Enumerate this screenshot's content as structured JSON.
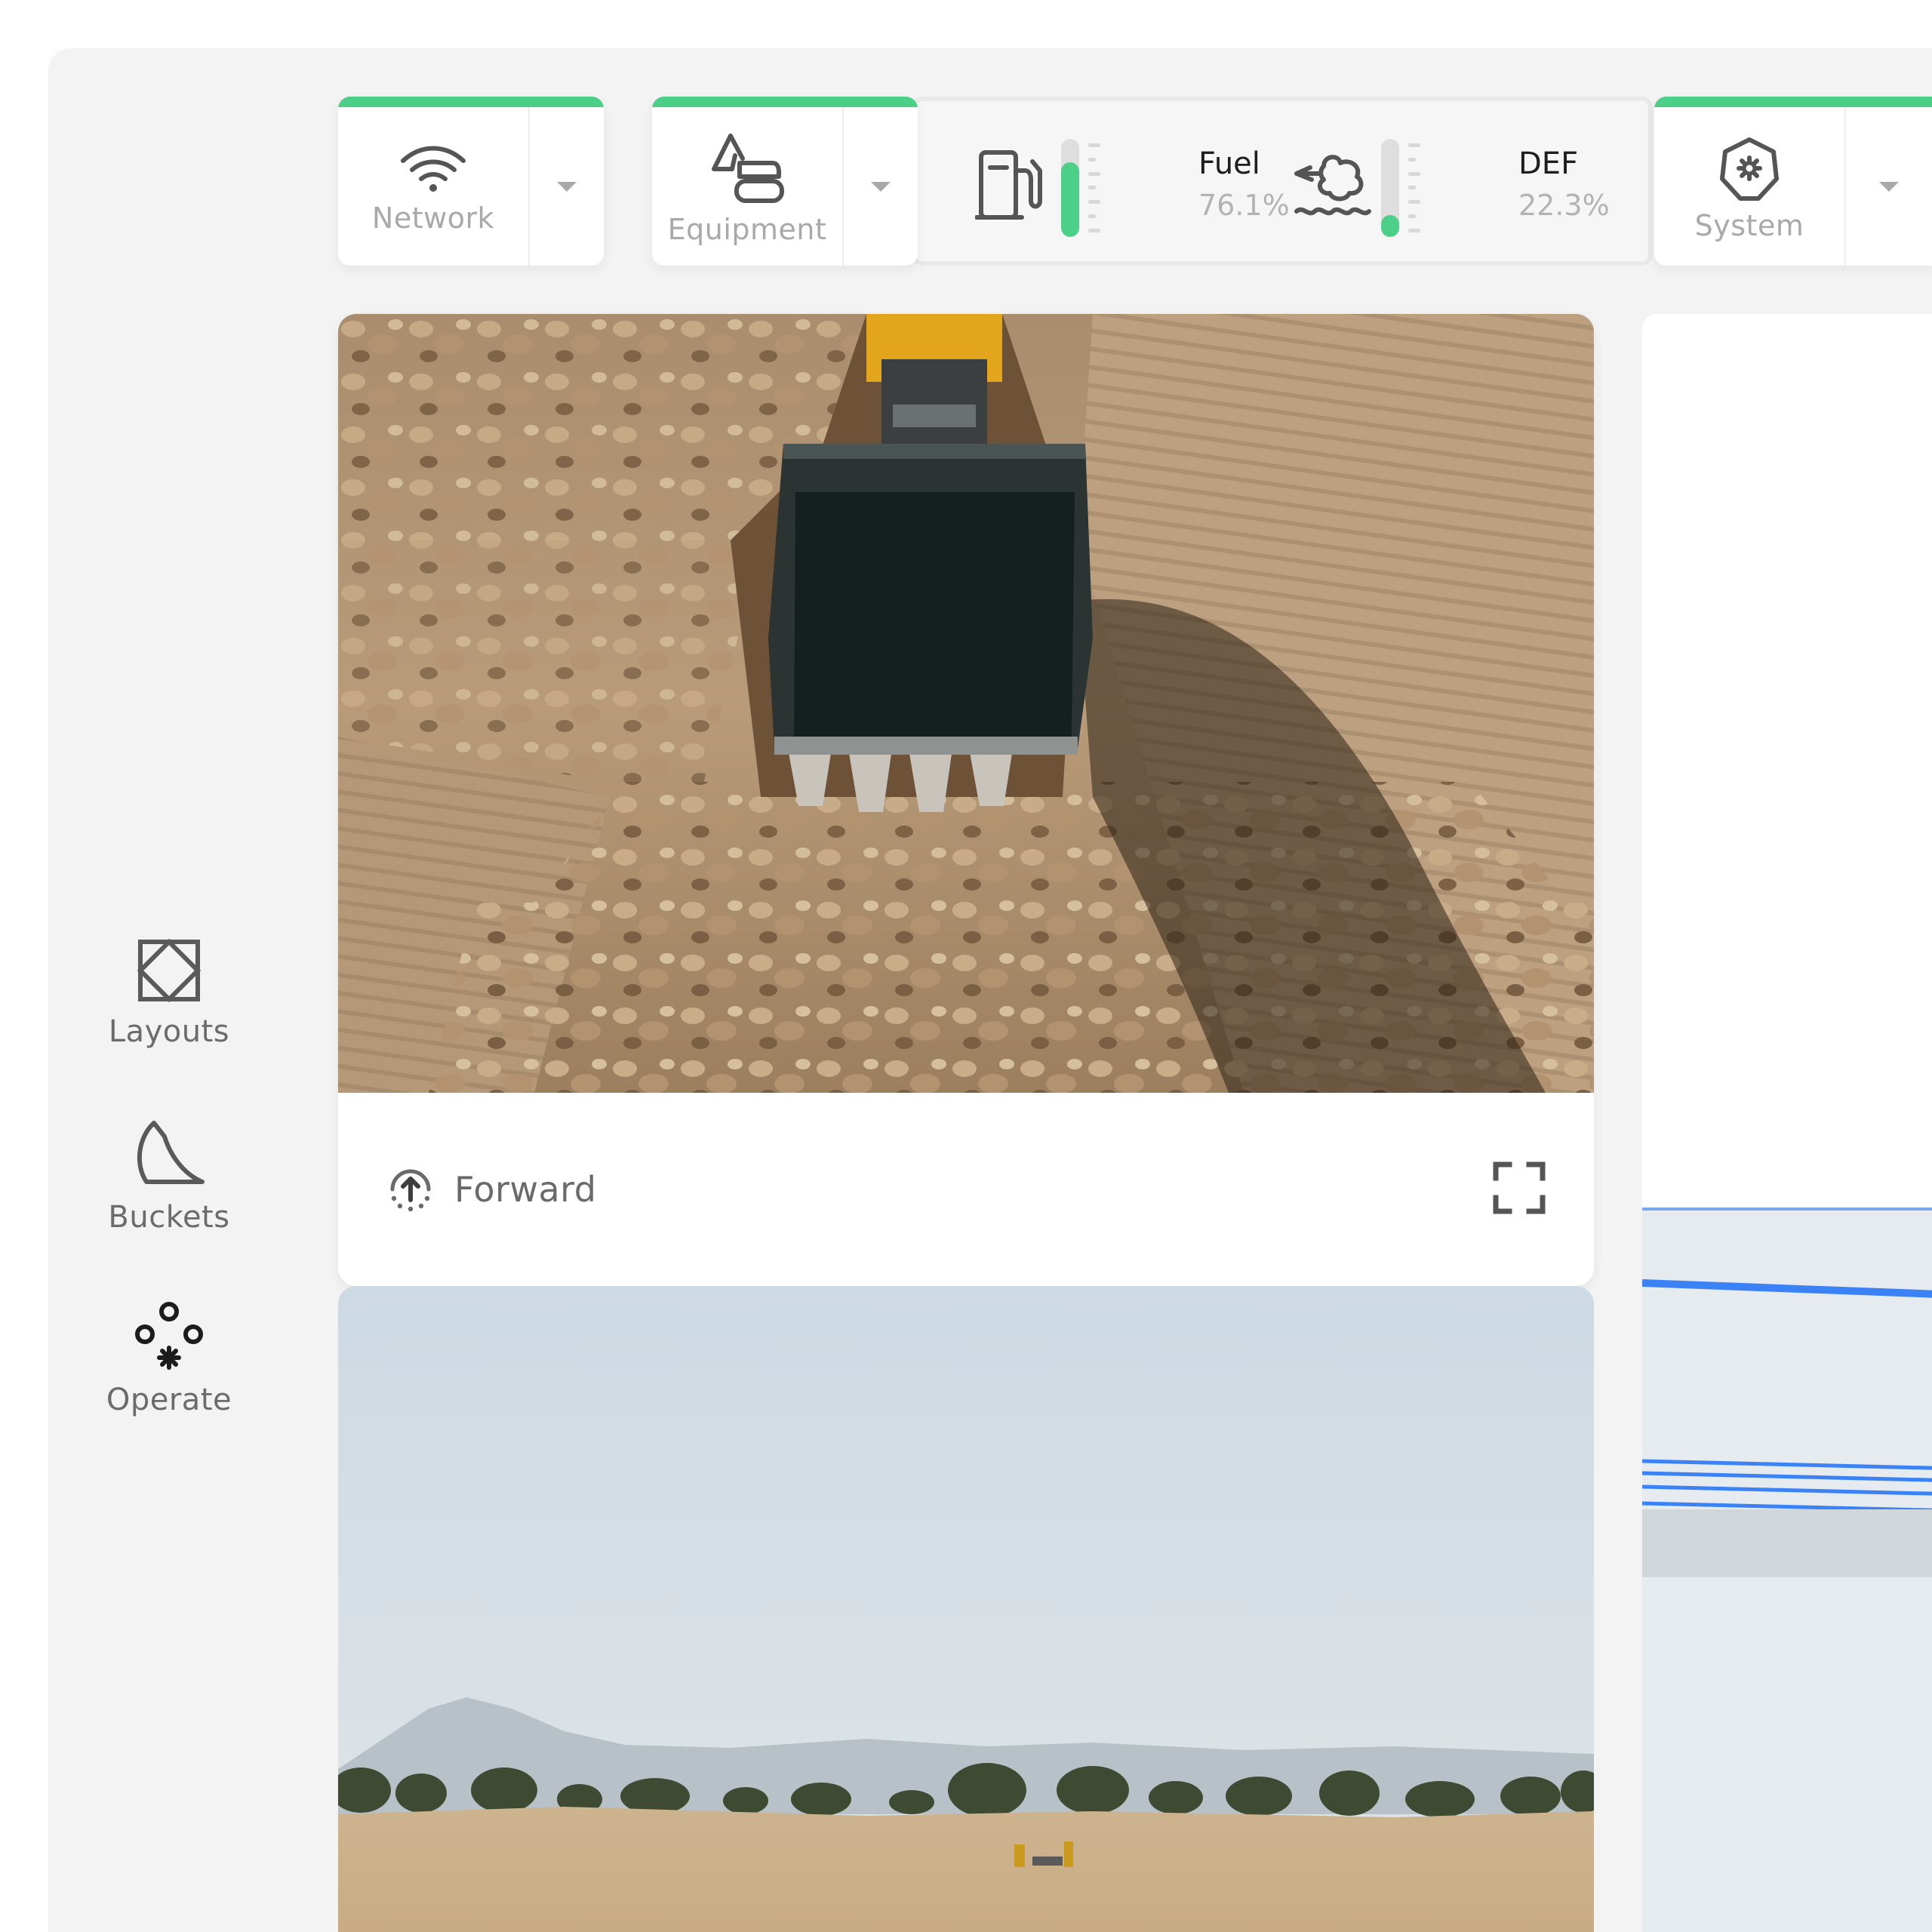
{
  "sidebar": {
    "items": [
      {
        "label": "Layouts",
        "icon": "layouts-icon"
      },
      {
        "label": "Buckets",
        "icon": "bucket-icon"
      },
      {
        "label": "Operate",
        "icon": "operate-icon"
      }
    ]
  },
  "status_bar": {
    "network": {
      "label": "Network",
      "icon": "wifi-icon"
    },
    "equipment": {
      "label": "Equipment",
      "icon": "excavator-icon"
    },
    "fuel": {
      "title": "Fuel",
      "value": "76.1%",
      "level": 0.761,
      "icon": "fuel-pump-icon"
    },
    "def": {
      "title": "DEF",
      "value": "22.3%",
      "level": 0.223,
      "icon": "def-fluid-icon"
    },
    "system": {
      "label": "System",
      "icon": "system-gear-icon"
    }
  },
  "cameras": [
    {
      "name": "Forward",
      "icon": "forward-camera-icon",
      "fullscreen_icon": "fullscreen-icon"
    }
  ],
  "colors": {
    "accent": "#4ccf87",
    "background": "#f3f3f3",
    "card": "#ffffff",
    "muted_text": "#a9a9a9",
    "right_panel_accent": "#8b5cf6",
    "lidar_blue": "#3b82f6"
  }
}
